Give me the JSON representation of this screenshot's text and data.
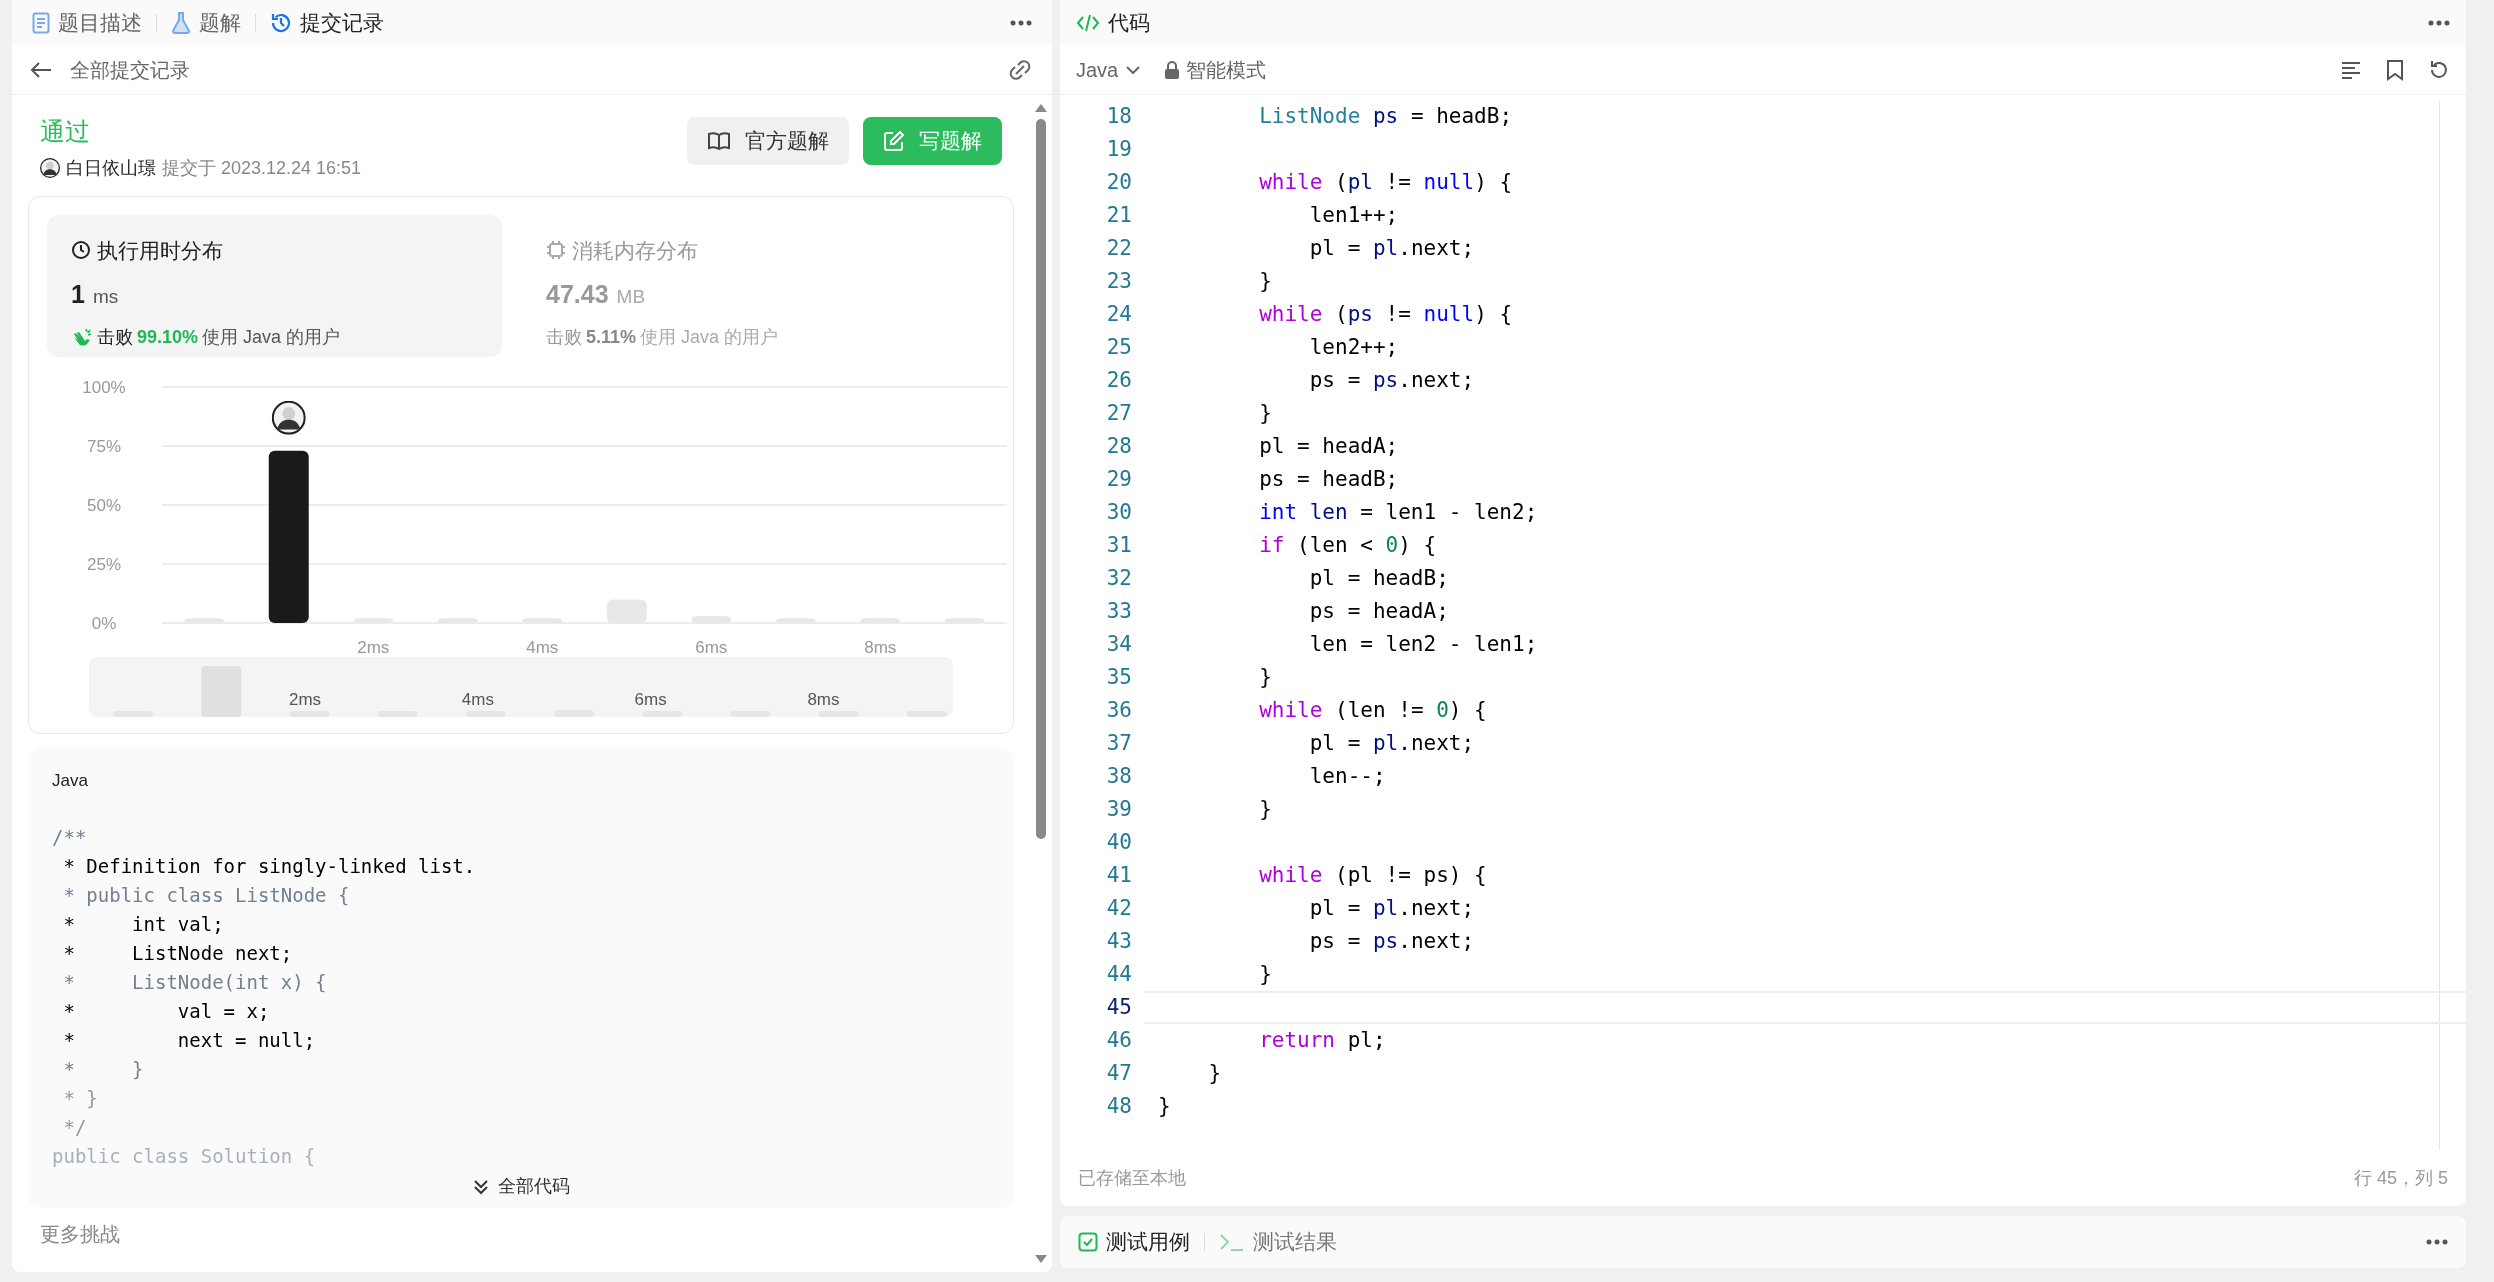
{
  "left_panel": {
    "tabs": [
      {
        "label": "题目描述",
        "selected": false
      },
      {
        "label": "题解",
        "selected": false
      },
      {
        "label": "提交记录",
        "selected": true
      }
    ],
    "back_label": "全部提交记录",
    "submission": {
      "status": "通过",
      "user": "白日依山璟",
      "submitted_at": "提交于 2023.12.24 16:51",
      "buttons": [
        {
          "label": "官方题解",
          "kind": "secondary"
        },
        {
          "label": "写题解",
          "kind": "primary"
        }
      ]
    },
    "stats": [
      {
        "title": "执行用时分布",
        "value": "1",
        "unit": "ms",
        "beat_prefix": "击败",
        "beat": "99.10%",
        "beat_suffix": "使用 Java 的用户",
        "selected": true
      },
      {
        "title": "消耗内存分布",
        "value": "47.43",
        "unit": "MB",
        "beat_prefix": "击败",
        "beat": "5.11%",
        "beat_suffix": "使用 Java 的用户",
        "selected": false
      }
    ],
    "chart_data": {
      "type": "bar",
      "x": [
        0,
        1,
        2,
        3,
        4,
        5,
        6,
        7,
        8,
        9
      ],
      "grid": true,
      "series": [
        {
          "color": "#e8e8e8",
          "values": [
            2,
            null,
            2,
            2,
            2,
            10,
            3,
            2,
            2,
            2
          ]
        },
        {
          "color": "#1a1a1a",
          "values": [
            null,
            73,
            null,
            null,
            null,
            null,
            null,
            null,
            null,
            null
          ]
        }
      ],
      "xlim": [
        -0.5,
        9.5
      ],
      "ylim": [
        0,
        100
      ],
      "yticks": [
        {
          "value": 0,
          "label": "0%"
        },
        {
          "value": 25,
          "label": "25%"
        },
        {
          "value": 50,
          "label": "50%"
        },
        {
          "value": 75,
          "label": "75%"
        },
        {
          "value": 100,
          "label": "100%"
        }
      ],
      "xticks": [
        {
          "value": 2,
          "label": "2ms"
        },
        {
          "value": 4,
          "label": "4ms"
        },
        {
          "value": 6,
          "label": "6ms"
        },
        {
          "value": 8,
          "label": "8ms"
        }
      ]
    },
    "overview_labels": [
      "2ms",
      "4ms",
      "6ms",
      "8ms"
    ],
    "code_block": {
      "language": "Java",
      "lines": [
        [
          {
            "kind": "comment",
            "text": "/**"
          }
        ],
        [
          {
            "kind": "plain",
            "text": " * Definition for singly-linked list."
          }
        ],
        [
          {
            "kind": "comment",
            "text": " * public class ListNode {"
          }
        ],
        [
          {
            "kind": "plain",
            "text": " *     int val;"
          }
        ],
        [
          {
            "kind": "plain",
            "text": " *     ListNode next;"
          }
        ],
        [
          {
            "kind": "comment",
            "text": " *     ListNode(int x) {"
          }
        ],
        [
          {
            "kind": "plain",
            "text": " *         val = x;"
          }
        ],
        [
          {
            "kind": "plain",
            "text": " *         next = null;"
          }
        ],
        [
          {
            "kind": "comment",
            "text": " *     }"
          }
        ],
        [
          {
            "kind": "comment",
            "text": " * }"
          }
        ],
        [
          {
            "kind": "comment",
            "text": " */"
          }
        ],
        [
          {
            "kind": "comment",
            "text": "public class Solution {"
          }
        ]
      ],
      "expand_label": "全部代码"
    },
    "more_label": "更多挑战"
  },
  "editor": {
    "title": "代码",
    "language": "Java",
    "mode": "智能模式",
    "lines": [
      {
        "no": "18",
        "tokens": [
          {
            "kind": "type",
            "text": "        ListNode"
          },
          {
            "kind": "var",
            "text": " ps"
          },
          {
            "kind": "plain",
            "text": " = headB;"
          }
        ]
      },
      {
        "no": "19"
      },
      {
        "no": "20",
        "tokens": [
          {
            "kind": "keyword",
            "text": "        while"
          },
          {
            "kind": "plain",
            "text": " ("
          },
          {
            "kind": "var",
            "text": "pl"
          },
          {
            "kind": "plain",
            "text": " != "
          },
          {
            "kind": "literal",
            "text": "null"
          },
          {
            "kind": "plain",
            "text": ") {"
          }
        ]
      },
      {
        "no": "21",
        "tokens": [
          {
            "kind": "plain",
            "text": "            len1++;"
          }
        ]
      },
      {
        "no": "22",
        "tokens": [
          {
            "kind": "plain",
            "text": "            pl = "
          },
          {
            "kind": "var",
            "text": "pl"
          },
          {
            "kind": "plain",
            "text": ".next;"
          }
        ]
      },
      {
        "no": "23",
        "tokens": [
          {
            "kind": "plain",
            "text": "        }"
          }
        ]
      },
      {
        "no": "24",
        "tokens": [
          {
            "kind": "keyword",
            "text": "        while"
          },
          {
            "kind": "plain",
            "text": " ("
          },
          {
            "kind": "var",
            "text": "ps"
          },
          {
            "kind": "plain",
            "text": " != "
          },
          {
            "kind": "literal",
            "text": "null"
          },
          {
            "kind": "plain",
            "text": ") {"
          }
        ]
      },
      {
        "no": "25",
        "tokens": [
          {
            "kind": "plain",
            "text": "            len2++;"
          }
        ]
      },
      {
        "no": "26",
        "tokens": [
          {
            "kind": "plain",
            "text": "            ps = "
          },
          {
            "kind": "var",
            "text": "ps"
          },
          {
            "kind": "plain",
            "text": ".next;"
          }
        ]
      },
      {
        "no": "27",
        "tokens": [
          {
            "kind": "plain",
            "text": "        }"
          }
        ]
      },
      {
        "no": "28",
        "tokens": [
          {
            "kind": "plain",
            "text": "        pl = headA;"
          }
        ]
      },
      {
        "no": "29",
        "tokens": [
          {
            "kind": "plain",
            "text": "        ps = headB;"
          }
        ]
      },
      {
        "no": "30",
        "tokens": [
          {
            "kind": "literal",
            "text": "        int"
          },
          {
            "kind": "var",
            "text": " len"
          },
          {
            "kind": "plain",
            "text": " = len1 - len2;"
          }
        ]
      },
      {
        "no": "31",
        "tokens": [
          {
            "kind": "keyword",
            "text": "        if"
          },
          {
            "kind": "plain",
            "text": " (len < "
          },
          {
            "kind": "number",
            "text": "0"
          },
          {
            "kind": "plain",
            "text": ") {"
          }
        ]
      },
      {
        "no": "32",
        "tokens": [
          {
            "kind": "plain",
            "text": "            pl = headB;"
          }
        ]
      },
      {
        "no": "33",
        "tokens": [
          {
            "kind": "plain",
            "text": "            ps = headA;"
          }
        ]
      },
      {
        "no": "34",
        "tokens": [
          {
            "kind": "plain",
            "text": "            len = len2 - len1;"
          }
        ]
      },
      {
        "no": "35",
        "tokens": [
          {
            "kind": "plain",
            "text": "        }"
          }
        ]
      },
      {
        "no": "36",
        "tokens": [
          {
            "kind": "keyword",
            "text": "        while"
          },
          {
            "kind": "plain",
            "text": " (len != "
          },
          {
            "kind": "number",
            "text": "0"
          },
          {
            "kind": "plain",
            "text": ") {"
          }
        ]
      },
      {
        "no": "37",
        "tokens": [
          {
            "kind": "plain",
            "text": "            pl = "
          },
          {
            "kind": "var",
            "text": "pl"
          },
          {
            "kind": "plain",
            "text": ".next;"
          }
        ]
      },
      {
        "no": "38",
        "tokens": [
          {
            "kind": "plain",
            "text": "            len--;"
          }
        ]
      },
      {
        "no": "39",
        "tokens": [
          {
            "kind": "plain",
            "text": "        }"
          }
        ]
      },
      {
        "no": "40"
      },
      {
        "no": "41",
        "tokens": [
          {
            "kind": "keyword",
            "text": "        while"
          },
          {
            "kind": "plain",
            "text": " (pl != ps) {"
          }
        ]
      },
      {
        "no": "42",
        "tokens": [
          {
            "kind": "plain",
            "text": "            pl = "
          },
          {
            "kind": "var",
            "text": "pl"
          },
          {
            "kind": "plain",
            "text": ".next;"
          }
        ]
      },
      {
        "no": "43",
        "tokens": [
          {
            "kind": "plain",
            "text": "            ps = "
          },
          {
            "kind": "var",
            "text": "ps"
          },
          {
            "kind": "plain",
            "text": ".next;"
          }
        ]
      },
      {
        "no": "44",
        "tokens": [
          {
            "kind": "plain",
            "text": "        }"
          }
        ]
      },
      {
        "no": "45",
        "current": true
      },
      {
        "no": "46",
        "tokens": [
          {
            "kind": "keyword",
            "text": "        return"
          },
          {
            "kind": "plain",
            "text": " pl;"
          }
        ]
      },
      {
        "no": "47",
        "tokens": [
          {
            "kind": "plain",
            "text": "    }"
          }
        ]
      },
      {
        "no": "48",
        "tokens": [
          {
            "kind": "plain",
            "text": "}"
          }
        ]
      }
    ],
    "saved_status": "已存储至本地",
    "cursor": "行 45，列 5"
  },
  "bottom_panel": {
    "tabs": [
      {
        "label": "测试用例",
        "selected": true
      },
      {
        "label": "测试结果",
        "selected": false
      }
    ]
  }
}
